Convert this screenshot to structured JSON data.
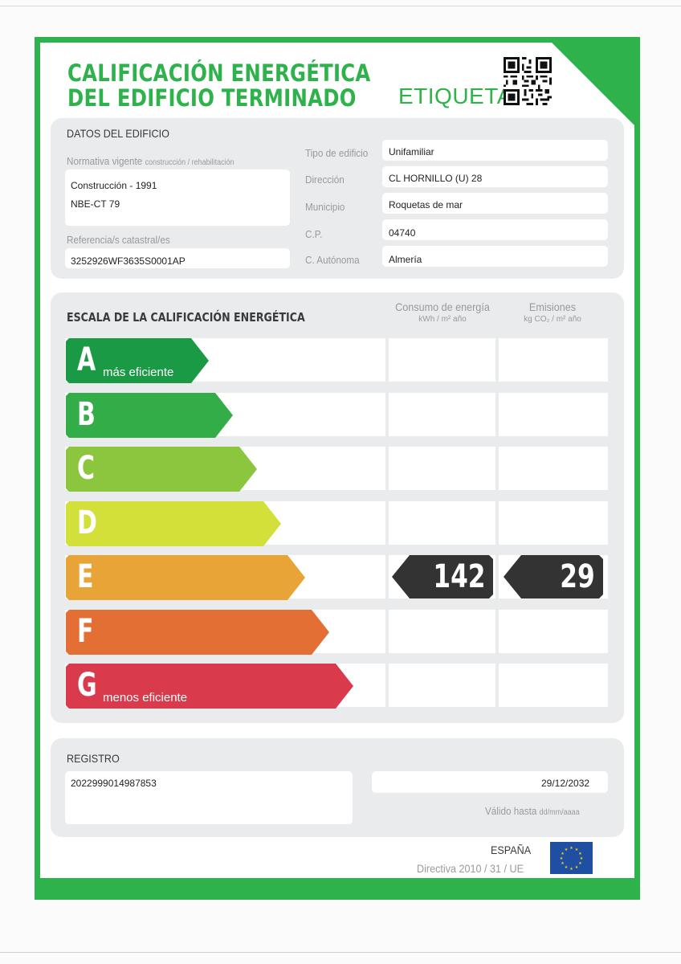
{
  "title": {
    "line1": "CALIFICACIÓN ENERGÉTICA",
    "line2": "DEL EDIFICIO TERMINADO",
    "label": "ETIQUETA"
  },
  "datos": {
    "heading": "DATOS DEL EDIFICIO",
    "normativa_label": "Normativa vigente",
    "normativa_label_small": "construcción / rehabilitación",
    "normativa_values": [
      "Construcción - 1991",
      "NBE-CT 79"
    ],
    "catastral_label": "Referencia/s catastral/es",
    "catastral_value": "3252926WF3635S0001AP",
    "fields": [
      {
        "label": "Tipo de edificio",
        "value": "Unifamiliar"
      },
      {
        "label": "Dirección",
        "value": "CL HORNILLO (U) 28"
      },
      {
        "label": "Municipio",
        "value": "Roquetas de mar"
      },
      {
        "label": "C.P.",
        "value": "04740"
      },
      {
        "label": "C. Autónoma",
        "value": "Almería"
      }
    ]
  },
  "escala": {
    "heading": "ESCALA DE LA CALIFICACIÓN ENERGÉTICA",
    "col_consumo": {
      "title": "Consumo de energía",
      "unit": "kWh / m² año"
    },
    "col_emisiones": {
      "title": "Emisiones",
      "unit": "kg CO₂ / m² año"
    },
    "classes": [
      {
        "letter": "A",
        "note": "más eficiente",
        "color": "#1a9a45"
      },
      {
        "letter": "B",
        "note": "",
        "color": "#33ad48"
      },
      {
        "letter": "C",
        "note": "",
        "color": "#8cc63f"
      },
      {
        "letter": "D",
        "note": "",
        "color": "#d3e03a"
      },
      {
        "letter": "E",
        "note": "",
        "color": "#e9a437"
      },
      {
        "letter": "F",
        "note": "",
        "color": "#e36f35"
      },
      {
        "letter": "G",
        "note": "menos eficiente",
        "color": "#d93a4c"
      }
    ],
    "rating": {
      "class": "E",
      "consumo": "142",
      "emisiones": "29",
      "badge_color": "#333333"
    }
  },
  "registro": {
    "heading": "REGISTRO",
    "number": "2022999014987853",
    "date": "29/12/2032",
    "valid_label": "Válido hasta",
    "valid_format": "dd/mm/aaaa"
  },
  "footer": {
    "country": "ESPAÑA",
    "directive": "Directiva 2010 / 31 / UE"
  },
  "colors": {
    "brand_green": "#2eb24b",
    "panel_gray": "#e9ebed"
  }
}
